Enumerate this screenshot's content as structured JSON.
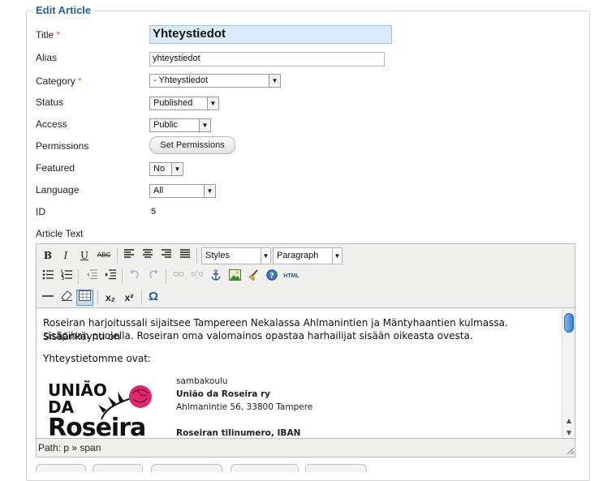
{
  "form": {
    "legend": "Edit Article",
    "required_marker": "*",
    "fields": {
      "title": {
        "label": "Title",
        "value": "Yhteystiedot"
      },
      "alias": {
        "label": "Alias",
        "value": "yhteystiedot"
      },
      "category": {
        "label": "Category",
        "value": "- Yhteystiedot"
      },
      "status": {
        "label": "Status",
        "value": "Published"
      },
      "access": {
        "label": "Access",
        "value": "Public"
      },
      "permissions": {
        "label": "Permissions",
        "button": "Set Permissions"
      },
      "featured": {
        "label": "Featured",
        "value": "No"
      },
      "language": {
        "label": "Language",
        "value": "All"
      },
      "id": {
        "label": "ID",
        "value": "5"
      },
      "article_text": {
        "label": "Article Text"
      }
    }
  },
  "editor": {
    "toolbar": {
      "bold": "B",
      "italic": "I",
      "underline": "U",
      "strike": "ABC",
      "styles": "Styles",
      "format": "Paragraph",
      "html": "HTML",
      "subscript": "x₂",
      "superscript": "x²",
      "omega": "Ω"
    },
    "content": {
      "para1_line1": "Roseiran harjoitussali sijaitsee Tampereen Nekalassa Ahlmanintien ja Mäntyhaantien kulmassa. Sisäänkäynti on",
      "para1_line2": "sisäpihan puolella. Roseiran oma valomainos opastaa harhailijat sisään oikeasta ovesta.",
      "para2": "Yhteystietomme ovat:",
      "logo_line1": "UNIÃO",
      "logo_line2": "DA",
      "logo_line3": "Roseira",
      "address": {
        "line1": "sambakoulu",
        "line2": "União da Roseira ry",
        "line3": "Ahlmanintie 56, 33800 Tampere",
        "line4": "Roseiran tilinumero, IBAN"
      }
    },
    "path": "Path: p » span"
  }
}
